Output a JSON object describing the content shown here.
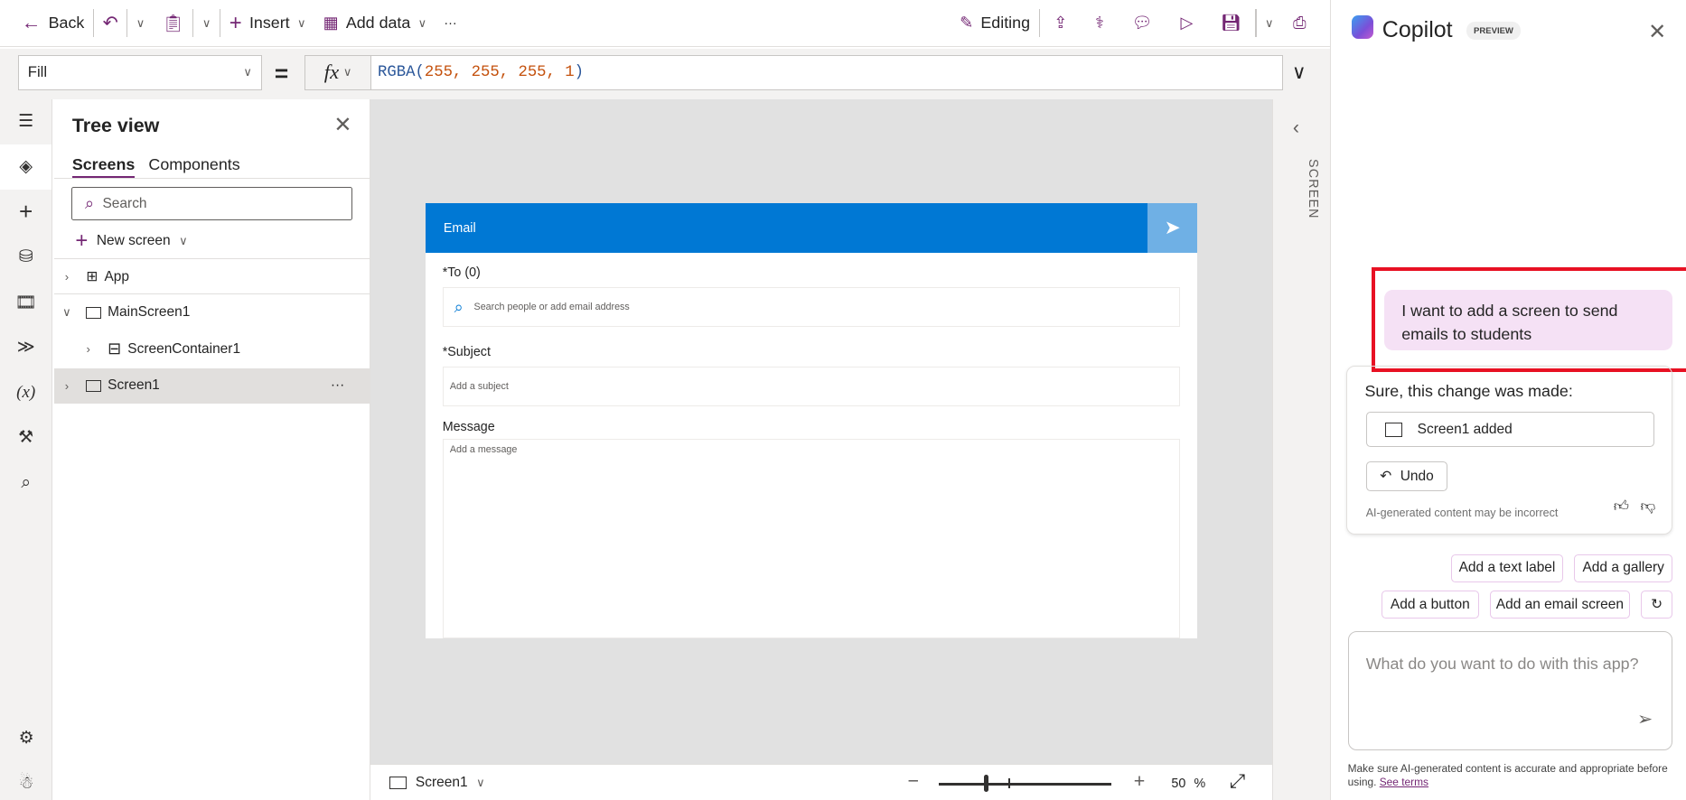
{
  "toolbar": {
    "back": "Back",
    "insert": "Insert",
    "add_data": "Add data",
    "more": "···",
    "editing": "Editing"
  },
  "formula": {
    "property": "Fill",
    "equals": "=",
    "fx": "fx",
    "func": "RGBA(",
    "args": "255, 255, 255, 1",
    "close": ")"
  },
  "tree": {
    "title": "Tree view",
    "tabs": [
      "Screens",
      "Components"
    ],
    "search_placeholder": "Search",
    "new_screen": "New screen",
    "items": [
      {
        "label": "App"
      },
      {
        "label": "MainScreen1"
      },
      {
        "label": "ScreenContainer1"
      },
      {
        "label": "Screen1"
      }
    ],
    "more": "···"
  },
  "email_screen": {
    "title": "Email",
    "to_label": "*To (0)",
    "to_placeholder": "Search people or add email address",
    "subject_label": "*Subject",
    "subject_placeholder": "Add a subject",
    "message_label": "Message",
    "message_placeholder": "Add a message",
    "header_color": "#0078d4"
  },
  "right_panel": {
    "label": "SCREEN"
  },
  "bottom": {
    "screen": "Screen1",
    "zoom_value": "50",
    "zoom_unit": "%",
    "zoom_percent": 50
  },
  "copilot": {
    "title": "Copilot",
    "badge": "PREVIEW",
    "user_message": "I want to add a screen to send emails to students",
    "response_title": "Sure, this change was made:",
    "change_item": "Screen1 added",
    "undo": "Undo",
    "disclaimer": "AI-generated content may be incorrect",
    "suggestions": [
      "Add a text label",
      "Add a gallery",
      "Add a button",
      "Add an email screen"
    ],
    "input_placeholder": "What do you want to do with this app?",
    "footer": "Make sure AI-generated content is accurate and appropriate before using.",
    "see_terms": "See terms"
  }
}
